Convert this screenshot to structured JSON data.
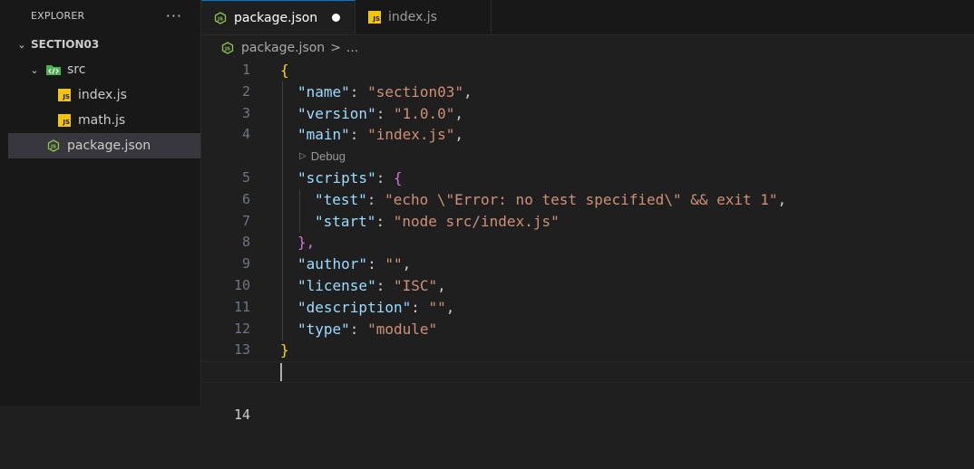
{
  "explorer": {
    "title": "EXPLORER",
    "more": "···",
    "section": "SECTION03",
    "folder": "src",
    "files": [
      "index.js",
      "math.js"
    ],
    "root_file": "package.json",
    "js_badge": "JS"
  },
  "tabs": [
    {
      "label": "package.json",
      "active": true,
      "dirty": true
    },
    {
      "label": "index.js",
      "active": false
    }
  ],
  "breadcrumb": {
    "file": "package.json",
    "sep": ">",
    "rest": "..."
  },
  "codelens": "Debug",
  "code": {
    "line_numbers": [
      "1",
      "2",
      "3",
      "4",
      "5",
      "6",
      "7",
      "8",
      "9",
      "10",
      "11",
      "12",
      "13",
      "14"
    ],
    "open_brace": "{",
    "close_brace": "}",
    "scripts_close": "},",
    "entries": [
      {
        "key": "\"name\"",
        "value": "\"section03\""
      },
      {
        "key": "\"version\"",
        "value": "\"1.0.0\""
      },
      {
        "key": "\"main\"",
        "value": "\"index.js\""
      },
      {
        "key": "\"scripts\""
      },
      {
        "key": "\"test\"",
        "value": "\"echo \\\"Error: no test specified\\\" && exit 1\""
      },
      {
        "key": "\"start\"",
        "value": "\"node src/index.js\""
      },
      {
        "key": "\"author\"",
        "value": "\"\""
      },
      {
        "key": "\"license\"",
        "value": "\"ISC\""
      },
      {
        "key": "\"description\"",
        "value": "\"\""
      },
      {
        "key": "\"type\"",
        "value": "\"module\""
      }
    ]
  },
  "colors": {
    "accent": "#0078d4",
    "string": "#ce9178",
    "key": "#9cdcfe",
    "brace": "#ffd700",
    "nested_brace": "#da70d6"
  }
}
